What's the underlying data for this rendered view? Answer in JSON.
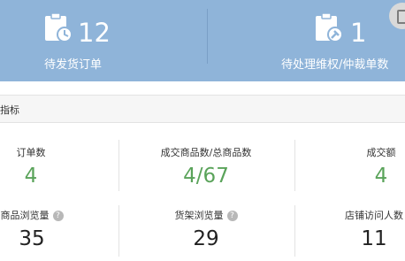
{
  "banner": {
    "left": {
      "number": "12",
      "label": "待发货订单",
      "icon": "clipboard-clock-icon"
    },
    "right": {
      "number": "1",
      "label": "待处理维权/仲裁单数",
      "icon": "clipboard-gavel-icon"
    },
    "corner_icon": "copy-icon"
  },
  "section": {
    "title": "指标"
  },
  "metrics_row1": [
    {
      "label": "订单数",
      "value": "4"
    },
    {
      "label": "成交商品数/总商品数",
      "value": "4/67"
    },
    {
      "label": "成交额",
      "value": "4"
    }
  ],
  "metrics_row2": [
    {
      "label": "商品浏览量",
      "value": "35"
    },
    {
      "label": "货架浏览量",
      "value": "29"
    },
    {
      "label": "店铺访问人数",
      "value": "11"
    }
  ],
  "colors": {
    "banner": "#8fb4d9",
    "metric_green": "#5aa35a"
  }
}
